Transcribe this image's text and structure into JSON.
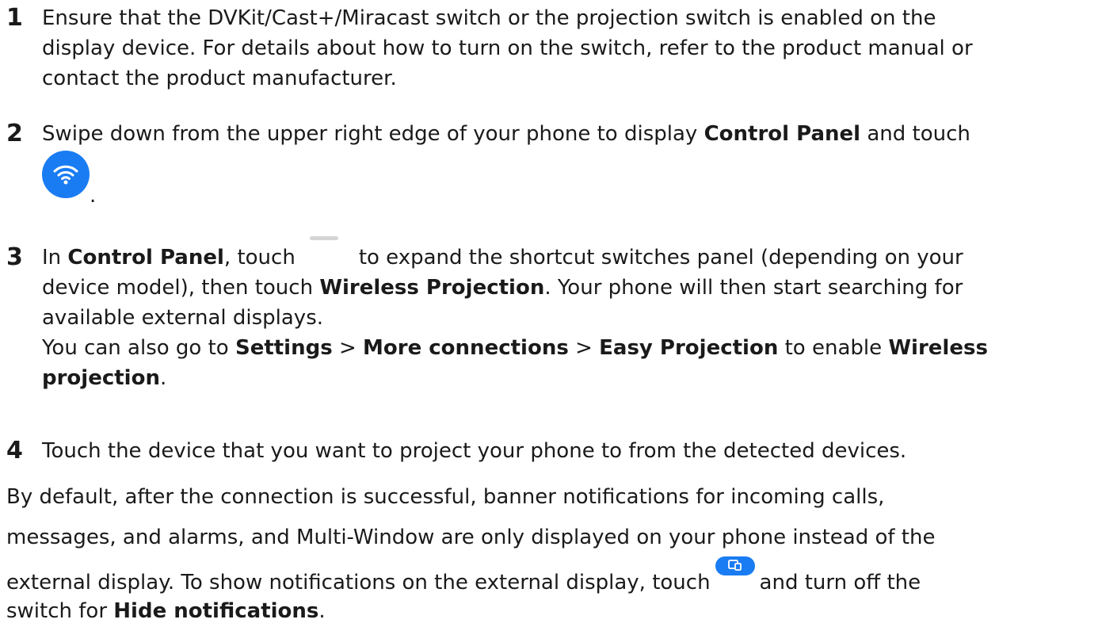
{
  "steps": [
    {
      "number": "1",
      "lines": [
        "Ensure that the DVKit/Cast+/Miracast switch or the projection switch is enabled on the",
        "display device. For details about how to turn on the switch, refer to the product manual or",
        "contact the product manufacturer."
      ]
    },
    {
      "number": "2",
      "text_before": "Swipe down from the upper right edge of your phone to display ",
      "bold_1": "Control Panel",
      "text_after": " and touch",
      "icon": "wifi-icon",
      "tail": "."
    },
    {
      "number": "3",
      "l1_a": "In ",
      "l1_bold": "Control Panel",
      "l1_b": ", touch",
      "l1_icon": "expand-handle-icon",
      "l1_c": "to expand the shortcut switches panel (depending on your",
      "l2_a": "device model), then touch ",
      "l2_bold": "Wireless Projection",
      "l2_b": ". Your phone will then start searching for",
      "l3": "available external displays.",
      "l4_a": "You can also go to ",
      "l4_bold_1": "Settings",
      "l4_sep_1": " > ",
      "l4_bold_2": "More connections",
      "l4_sep_2": " > ",
      "l4_bold_3": "Easy Projection",
      "l4_b": " to enable ",
      "l4_bold_4": "Wireless",
      "l5_bold": "projection",
      "l5_tail": "."
    },
    {
      "number": "4",
      "text": "Touch the device that you want to project your phone to from the detected devices."
    }
  ],
  "paragraph": {
    "line_1": "By default, after the connection is successful, banner notifications for incoming calls,",
    "line_2": "messages, and alarms, and Multi-Window are only displayed on your phone instead of the",
    "line_3_a": "external display. To show notifications on the external display, touch",
    "line_3_icon": "projection-settings-icon",
    "line_3_b": "and turn off the",
    "line_4_a": "switch for ",
    "line_4_bold": "Hide notifications",
    "line_4_tail": "."
  },
  "colors": {
    "accent": "#1a7cf3",
    "text": "#1a1a1a"
  }
}
